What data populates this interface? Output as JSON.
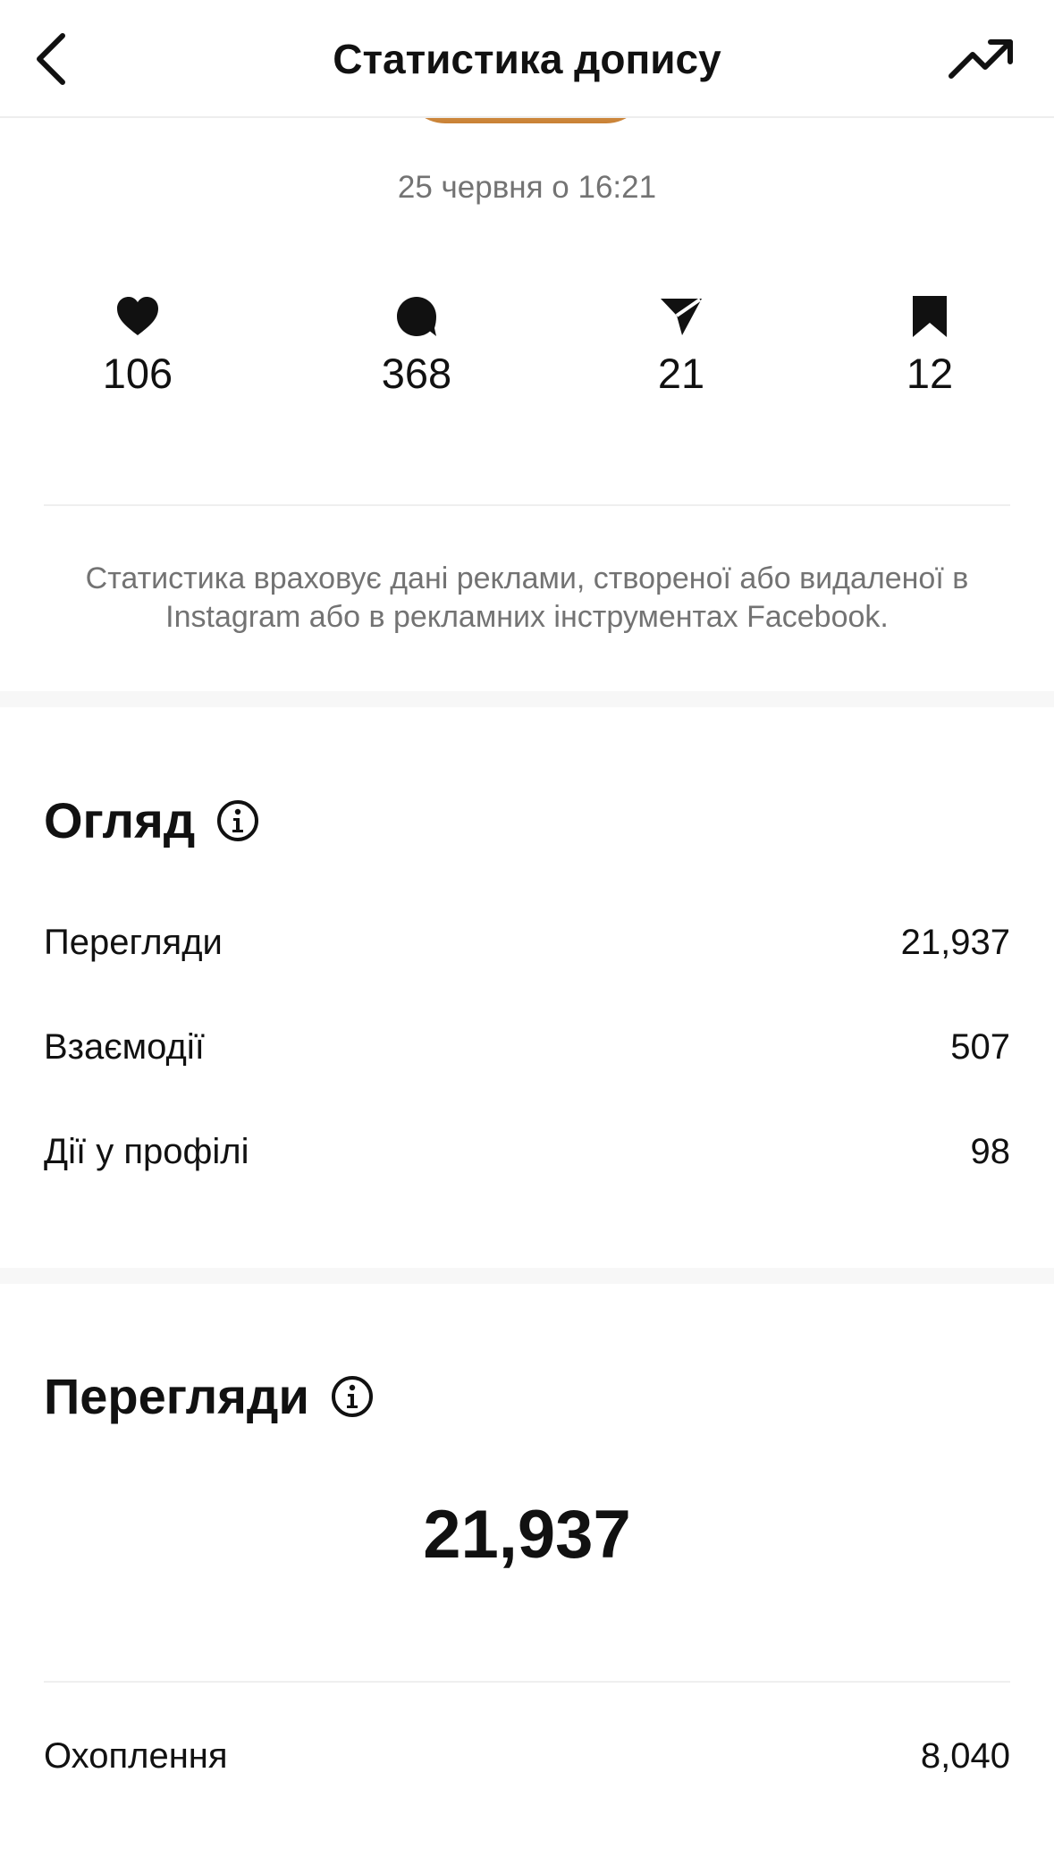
{
  "header": {
    "title": "Статистика допису"
  },
  "post": {
    "date": "25 червня о 16:21"
  },
  "engagement": {
    "likes": "106",
    "comments": "368",
    "shares": "21",
    "saves": "12"
  },
  "disclaimer": "Статистика враховує дані реклами, створеної або видаленої в Instagram або в рекламних інструментах Facebook.",
  "overview": {
    "title": "Огляд",
    "rows": [
      {
        "label": "Перегляди",
        "value": "21,937"
      },
      {
        "label": "Взаємодії",
        "value": "507"
      },
      {
        "label": "Дії у профілі",
        "value": "98"
      }
    ]
  },
  "views": {
    "title": "Перегляди",
    "total": "21,937",
    "reach_label": "Охоплення",
    "reach_value": "8,040"
  },
  "icons": {
    "back": "chevron-left-icon",
    "trend": "trending-up-icon",
    "likes": "heart-icon",
    "comments": "comment-bubble-icon",
    "shares": "paper-plane-icon",
    "saves": "bookmark-icon",
    "info": "info-circle-icon"
  }
}
